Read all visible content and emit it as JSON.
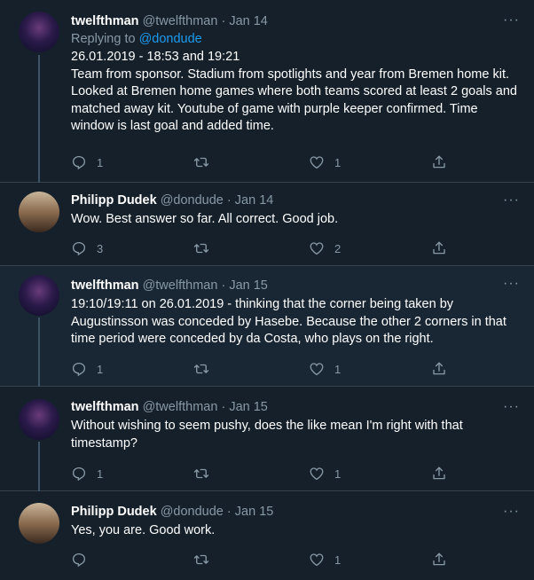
{
  "tweets": [
    {
      "name": "twelfthman",
      "handle": "@twelfthman",
      "date": "Jan 14",
      "reply_prefix": "Replying to ",
      "reply_to": "@dondude",
      "text_line1": "26.01.2019 - 18:53 and 19:21",
      "text": "Team from sponsor. Stadium from spotlights and year from Bremen home kit. Looked at Bremen home games where both teams scored at least 2 goals and matched away kit. Youtube of game with purple keeper confirmed. Time window is last goal and added time.",
      "replies": "1",
      "retweets": "",
      "likes": "1"
    },
    {
      "name": "Philipp Dudek",
      "handle": "@dondude",
      "date": "Jan 14",
      "text": "Wow. Best answer so far. All correct. Good job.",
      "replies": "3",
      "retweets": "",
      "likes": "2"
    },
    {
      "name": "twelfthman",
      "handle": "@twelfthman",
      "date": "Jan 15",
      "text": "19:10/19:11 on 26.01.2019 - thinking that the corner being taken by Augustinsson was conceded by Hasebe. Because the other 2 corners in that time period were conceded by da Costa, who plays on the right.",
      "replies": "1",
      "retweets": "",
      "likes": "1"
    },
    {
      "name": "twelfthman",
      "handle": "@twelfthman",
      "date": "Jan 15",
      "text": "Without wishing to seem pushy, does the like mean I'm right with that timestamp?",
      "replies": "1",
      "retweets": "",
      "likes": "1"
    },
    {
      "name": "Philipp Dudek",
      "handle": "@dondude",
      "date": "Jan 15",
      "text": "Yes, you are. Good work.",
      "replies": "",
      "retweets": "",
      "likes": "1"
    }
  ],
  "separator": "·",
  "more_glyph": "···",
  "colors": {
    "background": "#15202b",
    "highlight": "#192734",
    "accent": "#1d9bf0",
    "muted": "#8899a6"
  }
}
